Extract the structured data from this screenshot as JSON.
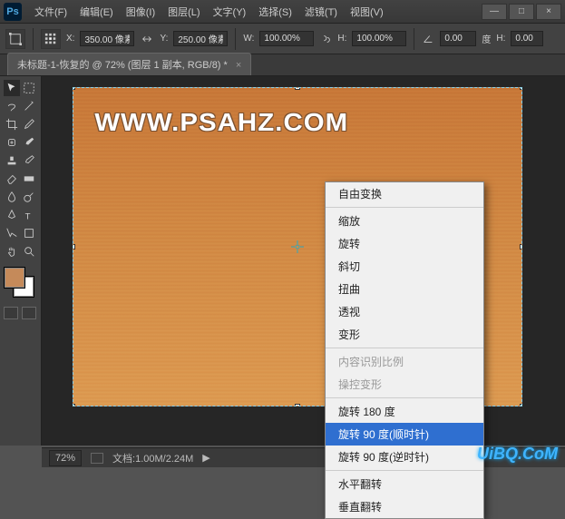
{
  "titlebar": {
    "logo": "Ps"
  },
  "menu": {
    "file": "文件(F)",
    "edit": "编辑(E)",
    "image": "图像(I)",
    "layer": "图层(L)",
    "type": "文字(Y)",
    "select": "选择(S)",
    "filter": "滤镜(T)",
    "view": "视图(V)"
  },
  "win": {
    "min": "—",
    "max": "□",
    "close": "×"
  },
  "opt": {
    "x_label": "X:",
    "x_val": "350.00 像素",
    "y_label": "Y:",
    "y_val": "250.00 像素",
    "w_label": "W:",
    "w_val": "100.00%",
    "h_label": "H:",
    "h_val": "100.00%",
    "angle_label": "",
    "angle_val": "0.00",
    "deg": "度",
    "h2_label": "H:",
    "h2_val": "0.00"
  },
  "tab": {
    "title": "未标题-1-恢复的 @ 72% (图层 1 副本, RGB/8) *",
    "close": "×"
  },
  "canvas": {
    "watermark": "WWW.PSAHZ.COM"
  },
  "ctx": {
    "free": "自由变换",
    "scale": "缩放",
    "rotate": "旋转",
    "skew": "斜切",
    "distort": "扭曲",
    "perspective": "透视",
    "warp": "变形",
    "content_aware": "内容识别比例",
    "puppet": "操控变形",
    "r180": "旋转 180 度",
    "r90cw": "旋转 90 度(顺时针)",
    "r90ccw": "旋转 90 度(逆时针)",
    "fliph": "水平翻转",
    "flipv": "垂直翻转"
  },
  "status": {
    "zoom": "72%",
    "doc": "文档:1.00M/2.24M",
    "arrow": "▶"
  },
  "brand": "UiBQ.CoM"
}
